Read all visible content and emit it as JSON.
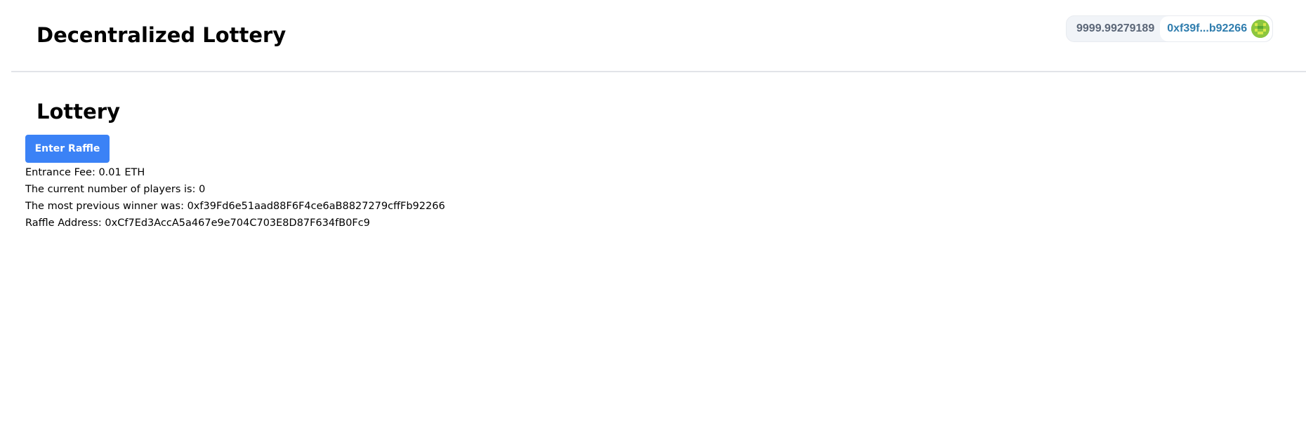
{
  "header": {
    "title": "Decentralized Lottery",
    "wallet": {
      "balance": "9999.99279189",
      "account": "0xf39f...b92266",
      "avatar_icon": "identicon-avatar",
      "avatar_color": "#8cc63f"
    }
  },
  "main": {
    "section_title": "Lottery",
    "enter_button_label": "Enter Raffle",
    "entrance_fee_line": "Entrance Fee: 0.01 ETH",
    "players_line": "The current number of players is: 0",
    "winner_line": "The most previous winner was: 0xf39Fd6e51aad88F6F4ce6aB8827279cffFb92266",
    "raffle_address_line": "Raffle Address: 0xCf7Ed3AccA5a467e9e704C703E8D87F634fB0Fc9"
  },
  "colors": {
    "button_background": "#3b82f6",
    "account_text": "#2f7dae",
    "balance_text": "#5b6677",
    "divider": "#e2e4e8"
  }
}
